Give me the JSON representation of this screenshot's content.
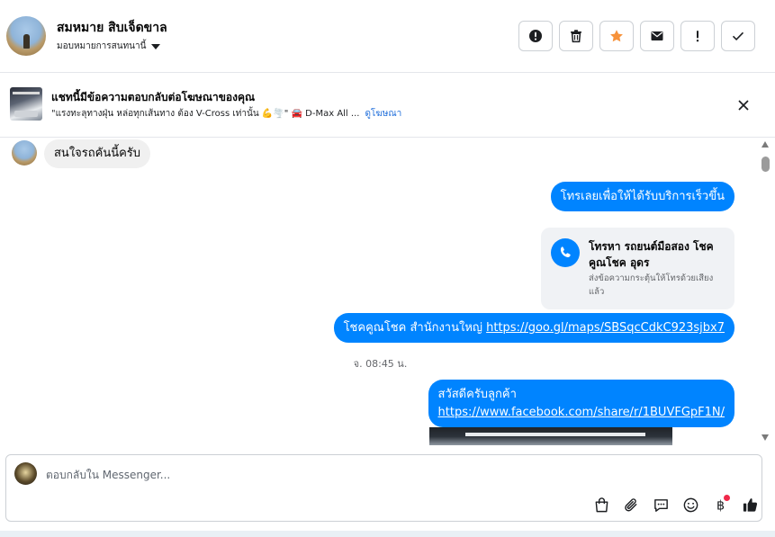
{
  "header": {
    "contact_name": "สมหมาย สิบเจ็ดขาล",
    "assign_label": "มอบหมายการสนทนานี้"
  },
  "ad_banner": {
    "title": "แชทนี้มีข้อความตอบกลับต่อโฆษณาของคุณ",
    "snippet": "\"แรงทะลุทางฝุ่น หล่อทุกเส้นทาง ต้อง V-Cross เท่านั้น 💪🌪️\" 🚘 D-Max All ...",
    "link_label": "ดูโฆษณา"
  },
  "messages": {
    "incoming": "สนใจรถคันนี้ครับ",
    "outgoing_1": "โทรเลยเพื่อให้ได้รับบริการเร็วขึ้น",
    "call_card_title": "โทรหา รถยนต์มือสอง โชคคูณโชค อุดร",
    "call_card_desc": "ส่งข้อความกระตุ้นให้โทรด้วยเสียงแล้ว",
    "outgoing_2_text": "โชคคูณโชค สำนักงานใหญ่ ",
    "outgoing_2_link": "https://goo.gl/maps/SBSqcCdkC923sjbx7",
    "timestamp": "จ. 08:45 น.",
    "outgoing_3_text": "สวัสดีครับลูกค้า",
    "outgoing_3_link": "https://www.facebook.com/share/r/1BUVFGpF1N/"
  },
  "composer": {
    "placeholder": "ตอบกลับใน Messenger..."
  },
  "colors": {
    "accent": "#0084ff",
    "star": "#f7923b",
    "notification_dot": "#f02849"
  }
}
